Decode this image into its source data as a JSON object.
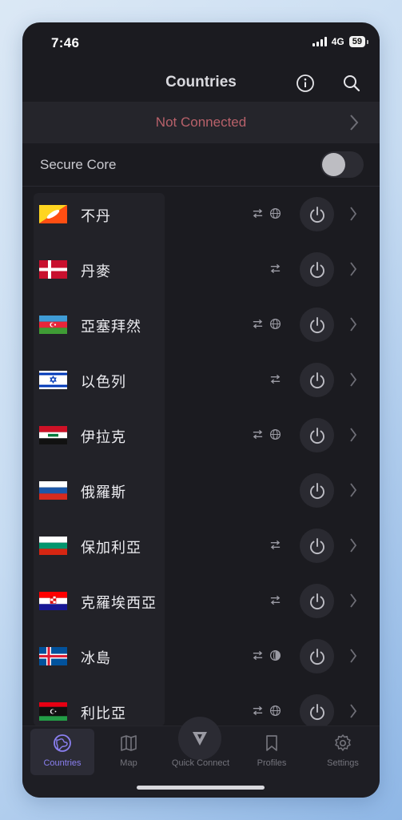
{
  "status": {
    "time": "7:46",
    "network": "4G",
    "battery": "59"
  },
  "nav": {
    "title": "Countries"
  },
  "connection": {
    "status": "Not Connected"
  },
  "secure_core": {
    "label": "Secure Core",
    "enabled": false
  },
  "countries": [
    {
      "name": "不丹",
      "flag": "bhutan",
      "features": [
        "p2p-icon",
        "tor-icon"
      ]
    },
    {
      "name": "丹麥",
      "flag": "denmark",
      "features": [
        "p2p-icon"
      ]
    },
    {
      "name": "亞塞拜然",
      "flag": "azerbaijan",
      "features": [
        "p2p-icon",
        "tor-icon"
      ]
    },
    {
      "name": "以色列",
      "flag": "israel",
      "features": [
        "p2p-icon"
      ]
    },
    {
      "name": "伊拉克",
      "flag": "iraq",
      "features": [
        "p2p-icon",
        "tor-icon"
      ]
    },
    {
      "name": "俄羅斯",
      "flag": "russia",
      "features": []
    },
    {
      "name": "保加利亞",
      "flag": "bulgaria",
      "features": [
        "p2p-icon"
      ]
    },
    {
      "name": "克羅埃西亞",
      "flag": "croatia",
      "features": [
        "p2p-icon"
      ]
    },
    {
      "name": "冰島",
      "flag": "iceland",
      "features": [
        "p2p-icon",
        "stream-icon"
      ]
    },
    {
      "name": "利比亞",
      "flag": "libya",
      "features": [
        "p2p-icon",
        "tor-icon"
      ]
    }
  ],
  "tabs": [
    {
      "label": "Countries",
      "icon": "globe-icon",
      "active": true
    },
    {
      "label": "Map",
      "icon": "map-icon",
      "active": false
    },
    {
      "label": "Quick Connect",
      "icon": "quick-connect-icon",
      "active": false
    },
    {
      "label": "Profiles",
      "icon": "bookmark-icon",
      "active": false
    },
    {
      "label": "Settings",
      "icon": "gear-icon",
      "active": false
    }
  ],
  "colors": {
    "accent": "#8a7ff0",
    "not_connected": "#b8616a",
    "background": "#1b1b20"
  }
}
